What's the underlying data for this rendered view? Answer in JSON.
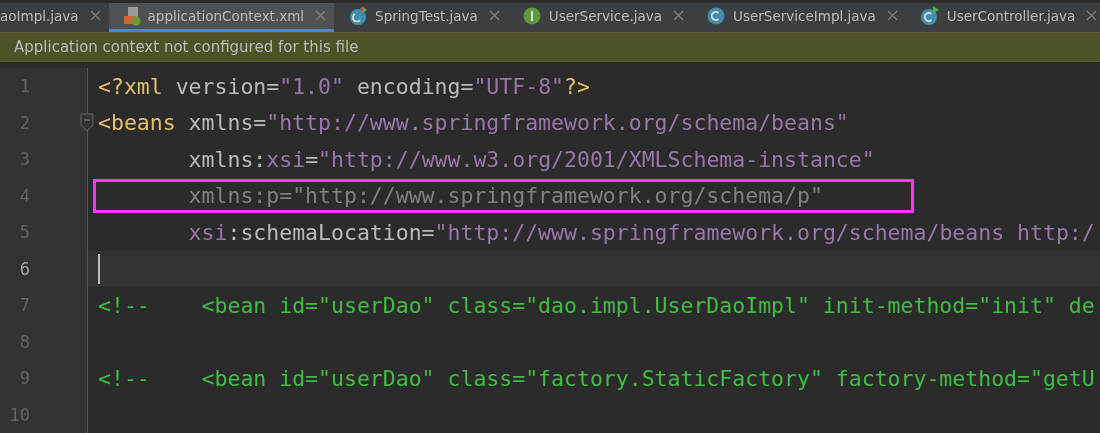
{
  "tabs": [
    {
      "label": "aoImpl.java",
      "kind": "none",
      "selected": false
    },
    {
      "label": "applicationContext.xml",
      "kind": "xml",
      "selected": true
    },
    {
      "label": "SpringTest.java",
      "kind": "test-class",
      "selected": false
    },
    {
      "label": "UserService.java",
      "kind": "interface",
      "selected": false
    },
    {
      "label": "UserServiceImpl.java",
      "kind": "class",
      "selected": false
    },
    {
      "label": "UserController.java",
      "kind": "runnable-class",
      "selected": false
    }
  ],
  "banner": {
    "text": "Application context not configured for this file"
  },
  "editor": {
    "lines": [
      {
        "number": "1",
        "current": false,
        "highlighted": false,
        "fold": false,
        "tokens": [
          {
            "kind": "tag",
            "text": "<?xml "
          },
          {
            "kind": "attr",
            "text": "version="
          },
          {
            "kind": "value",
            "text": "\"1.0\" "
          },
          {
            "kind": "attr",
            "text": "encoding="
          },
          {
            "kind": "value",
            "text": "\"UTF-8\""
          },
          {
            "kind": "tag",
            "text": "?>"
          }
        ]
      },
      {
        "number": "2",
        "current": false,
        "highlighted": false,
        "fold": true,
        "tokens": [
          {
            "kind": "tag",
            "text": "<beans "
          },
          {
            "kind": "attr",
            "text": "xmlns="
          },
          {
            "kind": "value",
            "text": "\"http://www.springframework.org/schema/beans\""
          }
        ]
      },
      {
        "number": "3",
        "current": false,
        "highlighted": false,
        "fold": false,
        "tokens": [
          {
            "kind": "attr",
            "text": "       xmlns:"
          },
          {
            "kind": "ns",
            "text": "xsi"
          },
          {
            "kind": "attr",
            "text": "="
          },
          {
            "kind": "value",
            "text": "\"http://www.w3.org/2001/XMLSchema-instance\""
          }
        ]
      },
      {
        "number": "4",
        "current": false,
        "highlighted": true,
        "fold": false,
        "tokens": [
          {
            "kind": "unused",
            "text": "       xmlns:p=\"http://www.springframework.org/schema/p\""
          }
        ]
      },
      {
        "number": "5",
        "current": false,
        "highlighted": false,
        "fold": false,
        "tokens": [
          {
            "kind": "ns",
            "text": "       xsi"
          },
          {
            "kind": "attr",
            "text": ":schemaLocation="
          },
          {
            "kind": "value",
            "text": "\"http://www.springframework.org/schema/beans http:/"
          }
        ]
      },
      {
        "number": "6",
        "current": true,
        "fold": false
      },
      {
        "number": "7",
        "current": false,
        "highlighted": false,
        "fold": false,
        "tokens": [
          {
            "kind": "comment",
            "text": "<!--    <bean id=\"userDao\" class=\"dao.impl.UserDaoImpl\" init-method=\"init\" de"
          }
        ]
      },
      {
        "number": "8",
        "current": false,
        "fold": false
      },
      {
        "number": "9",
        "current": false,
        "highlighted": false,
        "fold": false,
        "tokens": [
          {
            "kind": "comment",
            "text": "<!--    <bean id=\"userDao\" class=\"factory.StaticFactory\" factory-method=\"getU"
          }
        ]
      },
      {
        "number": "10",
        "current": false,
        "fold": false
      }
    ]
  }
}
